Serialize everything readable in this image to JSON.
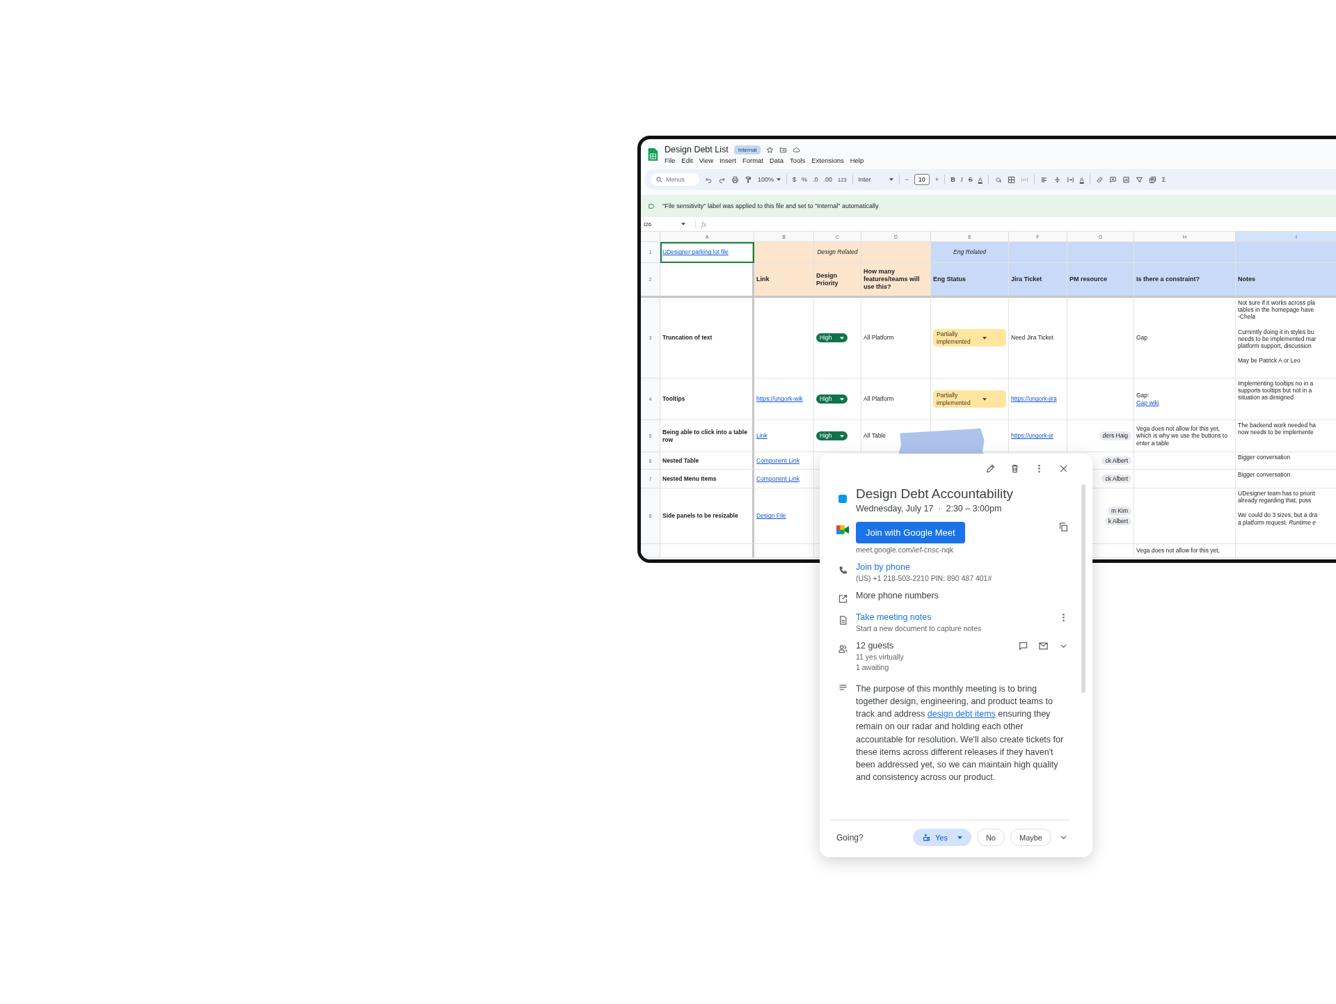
{
  "app": {
    "title": "Design Debt List",
    "badge": "Internal",
    "menu": [
      "File",
      "Edit",
      "View",
      "Insert",
      "Format",
      "Data",
      "Tools",
      "Extensions",
      "Help"
    ]
  },
  "toolbar": {
    "search_placeholder": "Menus",
    "zoom": "100%",
    "currency": "$",
    "percent": "%",
    "decimal_decrease": ".0",
    "decimal_increase": ".00",
    "number_format": "123",
    "font": "Inter",
    "minus": "−",
    "font_size": "10",
    "plus": "+",
    "bold": "B",
    "italic": "I",
    "strikethrough": "S",
    "text_color": "A",
    "text_rotation": "A",
    "sum": "Σ"
  },
  "banner": "\"File sensitivity\" label was applied to this file and set to \"Internal\" automatically",
  "formula_bar": {
    "cell_ref": "I26",
    "fx": "fx"
  },
  "sheet": {
    "columns": [
      {
        "label": "A",
        "selected": false
      },
      {
        "label": "B",
        "selected": false
      },
      {
        "label": "C",
        "selected": false
      },
      {
        "label": "D",
        "selected": false
      },
      {
        "label": "E",
        "selected": false
      },
      {
        "label": "F",
        "selected": false
      },
      {
        "label": "G",
        "selected": false
      },
      {
        "label": "H",
        "selected": false
      },
      {
        "label": "I",
        "selected": true
      }
    ],
    "rows": [
      {
        "number": "1",
        "cells": [
          {
            "kind": "link",
            "text": "UDesigner parking lot file",
            "selected": true
          },
          {
            "kind": "empty",
            "color": "#fce5cd"
          },
          {
            "kind": "group",
            "text": "Design Related",
            "color": "#fce5cd"
          },
          {
            "kind": "empty",
            "color": "#fce5cd"
          },
          {
            "kind": "group",
            "text": "Eng Related",
            "color": "#c9daf8"
          },
          {
            "kind": "empty",
            "color": "#c9daf8"
          },
          {
            "kind": "empty",
            "color": "#c9daf8"
          },
          {
            "kind": "empty",
            "color": "#c9daf8"
          },
          {
            "kind": "empty",
            "color": "#c9daf8"
          }
        ]
      },
      {
        "number": "2",
        "cells": [
          {
            "kind": "empty"
          },
          {
            "kind": "header",
            "text": "Link",
            "color": "#fce5cd"
          },
          {
            "kind": "header",
            "text": "Design Priority",
            "color": "#fce5cd"
          },
          {
            "kind": "header",
            "text": "How many features/teams will use this?",
            "color": "#fce5cd"
          },
          {
            "kind": "header",
            "text": "Eng Status",
            "color": "#c9daf8"
          },
          {
            "kind": "header",
            "text": "Jira Ticket",
            "color": "#c9daf8"
          },
          {
            "kind": "header",
            "text": "PM resource",
            "color": "#c9daf8"
          },
          {
            "kind": "header",
            "text": "Is there a constraint?",
            "color": "#c9daf8"
          },
          {
            "kind": "header",
            "text": "Notes",
            "color": "#c9daf8"
          }
        ]
      },
      {
        "number": "3",
        "cells": [
          {
            "kind": "title",
            "text": "Truncation of text"
          },
          {
            "kind": "empty"
          },
          {
            "kind": "priority",
            "text": "High"
          },
          {
            "kind": "text",
            "text": "All Platform"
          },
          {
            "kind": "status",
            "text": "Partially implemented"
          },
          {
            "kind": "text",
            "text": "Need Jira Ticket"
          },
          {
            "kind": "empty"
          },
          {
            "kind": "text",
            "text": "Gap"
          },
          {
            "kind": "notes",
            "paragraphs": [
              [
                "Not sure if it works across pla",
                "tables in the homepage have",
                "-Chela"
              ],
              [
                "Currently doing it in styles bu",
                "needs to be implemented mar",
                "platform support, discussion"
              ],
              [
                "May be Patrick A or Leo"
              ]
            ]
          }
        ]
      },
      {
        "number": "4",
        "cells": [
          {
            "kind": "title",
            "text": "Tooltips"
          },
          {
            "kind": "link",
            "text": "https://ungork-wik"
          },
          {
            "kind": "priority",
            "text": "High"
          },
          {
            "kind": "text",
            "text": "All Platform"
          },
          {
            "kind": "status",
            "text": "Partially implemented"
          },
          {
            "kind": "link",
            "text": "https://ungork-jira"
          },
          {
            "kind": "empty"
          },
          {
            "kind": "label_link",
            "text": "Gap:",
            "link": "Gap wiki"
          },
          {
            "kind": "notes",
            "paragraphs": [
              [
                "Implementing tooltips no in a",
                "supports tooltips but not in a",
                "situation as designed"
              ]
            ]
          }
        ]
      },
      {
        "number": "5",
        "cells": [
          {
            "kind": "title",
            "text": "Being able to click into a table row"
          },
          {
            "kind": "link",
            "text": "Link"
          },
          {
            "kind": "priority",
            "text": "High"
          },
          {
            "kind": "text",
            "text": "All Table"
          },
          {
            "kind": "empty"
          },
          {
            "kind": "link",
            "text": "https://ungork-jir"
          },
          {
            "kind": "people",
            "names": [
              "ders Haig"
            ]
          },
          {
            "kind": "text",
            "text": "Vega does not allow for this yet, which is why we use the buttons to enter a table"
          },
          {
            "kind": "notes",
            "paragraphs": [
              [
                "The backend work needed ha",
                "now needs to be implemente"
              ]
            ]
          }
        ]
      },
      {
        "number": "6",
        "cells": [
          {
            "kind": "title",
            "text": "Nested Table"
          },
          {
            "kind": "link",
            "text": "Component Link"
          },
          {
            "kind": "empty"
          },
          null,
          {
            "kind": "empty"
          },
          {
            "kind": "empty"
          },
          {
            "kind": "people",
            "names": [
              "ck Albert"
            ]
          },
          {
            "kind": "empty"
          },
          {
            "kind": "notes",
            "paragraphs": [
              [
                "Bigger conversation"
              ]
            ]
          }
        ]
      },
      {
        "number": "7",
        "cells": [
          {
            "kind": "title",
            "text": "Nested Menu Items"
          },
          {
            "kind": "link",
            "text": "Component Link"
          },
          {
            "kind": "empty"
          },
          null,
          null,
          null,
          {
            "kind": "people",
            "names": [
              "ck Albert"
            ]
          },
          {
            "kind": "empty"
          },
          {
            "kind": "notes",
            "paragraphs": [
              [
                "Bigger conversation"
              ]
            ]
          }
        ]
      },
      {
        "number": "8",
        "cells": [
          {
            "kind": "title",
            "text": "Side panels to be resizable"
          },
          {
            "kind": "link",
            "text": "Design File"
          },
          {
            "kind": "empty"
          },
          {
            "kind": "empty"
          },
          {
            "kind": "empty"
          },
          {
            "kind": "empty"
          },
          {
            "kind": "people",
            "names": [
              "m Kim",
              "k Albert"
            ]
          },
          {
            "kind": "empty"
          },
          {
            "kind": "notes",
            "paragraphs": [
              [
                "UDesigner team has to priorit",
                "already regarding that, poss"
              ],
              [
                "We could do 3 sizes, but a dra",
                "a platform request. *Runtime e*"
              ]
            ]
          }
        ]
      },
      {
        "cells": [
          {
            "kind": "empty"
          },
          {
            "kind": "empty"
          },
          {
            "kind": "empty"
          },
          {
            "kind": "empty"
          },
          {
            "kind": "empty"
          },
          {
            "kind": "empty"
          },
          {
            "kind": "empty"
          },
          {
            "kind": "text",
            "text": "Vega does not allow for this yet,"
          },
          {
            "kind": "empty"
          }
        ]
      }
    ]
  },
  "event": {
    "title": "Design Debt Accountability",
    "color": "#039be5",
    "when": "Wednesday, July 17  ·  2:30 – 3:00pm",
    "join_button": "Join with Google Meet",
    "meet_url": "meet.google.com/ief-cnsc-nqk",
    "phone_link": "Join by phone",
    "phone_details": "(US) +1 218-503-2210 PIN: 890 487 401#",
    "more_phones": "More phone numbers",
    "notes_link": "Take meeting notes",
    "notes_hint": "Start a new document to capture notes",
    "guests": {
      "count": "12 guests",
      "yes": "11 yes virtually",
      "awaiting": "1 awaiting"
    },
    "description_before": "The purpose of this monthly meeting is to bring together design, engineering, and product teams to track and address ",
    "description_link": "design debt items",
    "description_after": " ensuring they remain on our radar and holding each other accountable for resolution. We'll also create tickets for these items across different releases if they haven't been addressed yet, so we can maintain high quality and consistency across our product.",
    "rsvp": {
      "prompt": "Going?",
      "options": [
        {
          "label": "Yes",
          "selected": true
        },
        {
          "label": "No",
          "selected": false
        },
        {
          "label": "Maybe",
          "selected": false
        }
      ]
    }
  }
}
